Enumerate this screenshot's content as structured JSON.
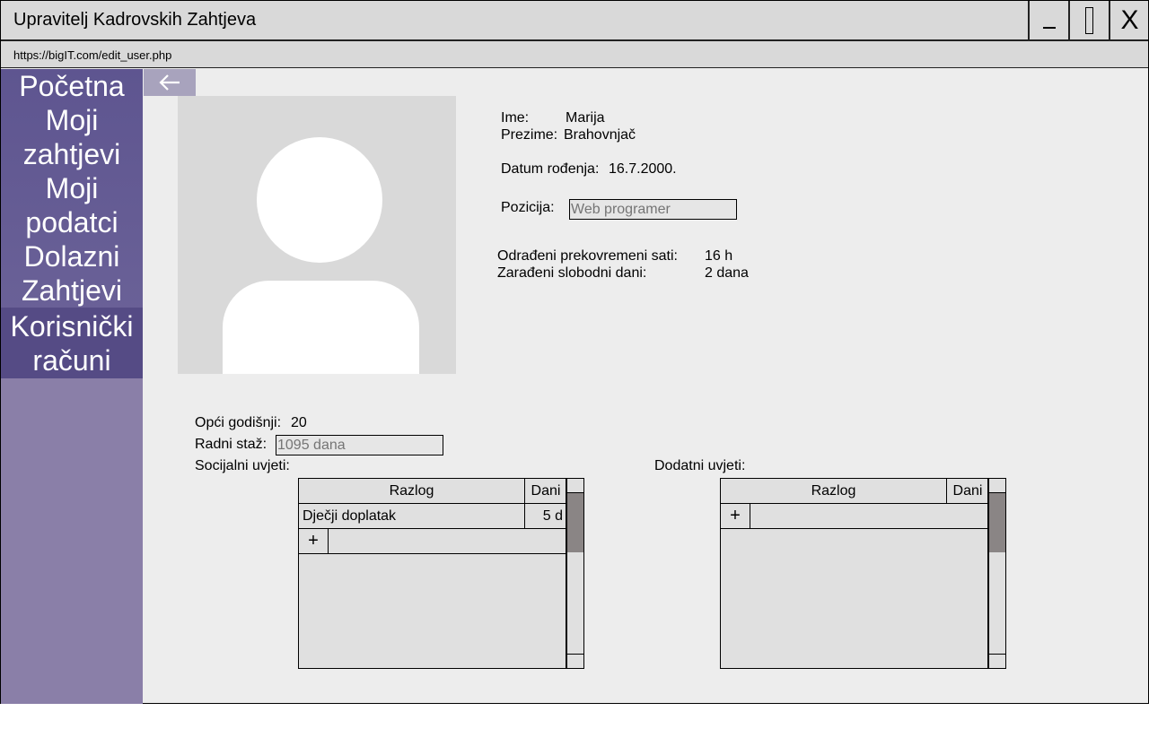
{
  "window": {
    "title": "Upravitelj Kadrovskih Zahtjeva",
    "close_label": "X",
    "url": "https://bigIT.com/edit_user.php"
  },
  "sidebar": {
    "items": [
      {
        "label": "Početna"
      },
      {
        "label": "Moji zahtjevi"
      },
      {
        "label": "Moji podatci"
      },
      {
        "label": "Dolazni Zahtjevi"
      },
      {
        "label": "Korisnički računi"
      }
    ]
  },
  "profile": {
    "name_label": "Ime:",
    "name_value": "Marija",
    "surname_label": "Prezime:",
    "surname_value": "Brahovnjač",
    "dob_label": "Datum rođenja:",
    "dob_value": "16.7.2000.",
    "position_label": "Pozicija:",
    "position_placeholder": "Web programer",
    "overtime_label": "Odrađeni prekovremeni sati:",
    "overtime_value": "16 h",
    "freedays_label": "Zarađeni slobodni dani:",
    "freedays_value": "2 dana"
  },
  "leave": {
    "annual_label": "Opći godišnji:",
    "annual_value": "20",
    "seniority_label": "Radni staž:",
    "seniority_placeholder": "1095 dana",
    "social_label": "Socijalni uvjeti:",
    "additional_label": "Dodatni uvjeti:"
  },
  "social_table": {
    "headers": {
      "reason": "Razlog",
      "days": "Dani"
    },
    "rows": [
      {
        "reason": "Dječji doplatak",
        "days": "5 d"
      }
    ],
    "add_label": "+"
  },
  "additional_table": {
    "headers": {
      "reason": "Razlog",
      "days": "Dani"
    },
    "rows": [],
    "add_label": "+"
  }
}
